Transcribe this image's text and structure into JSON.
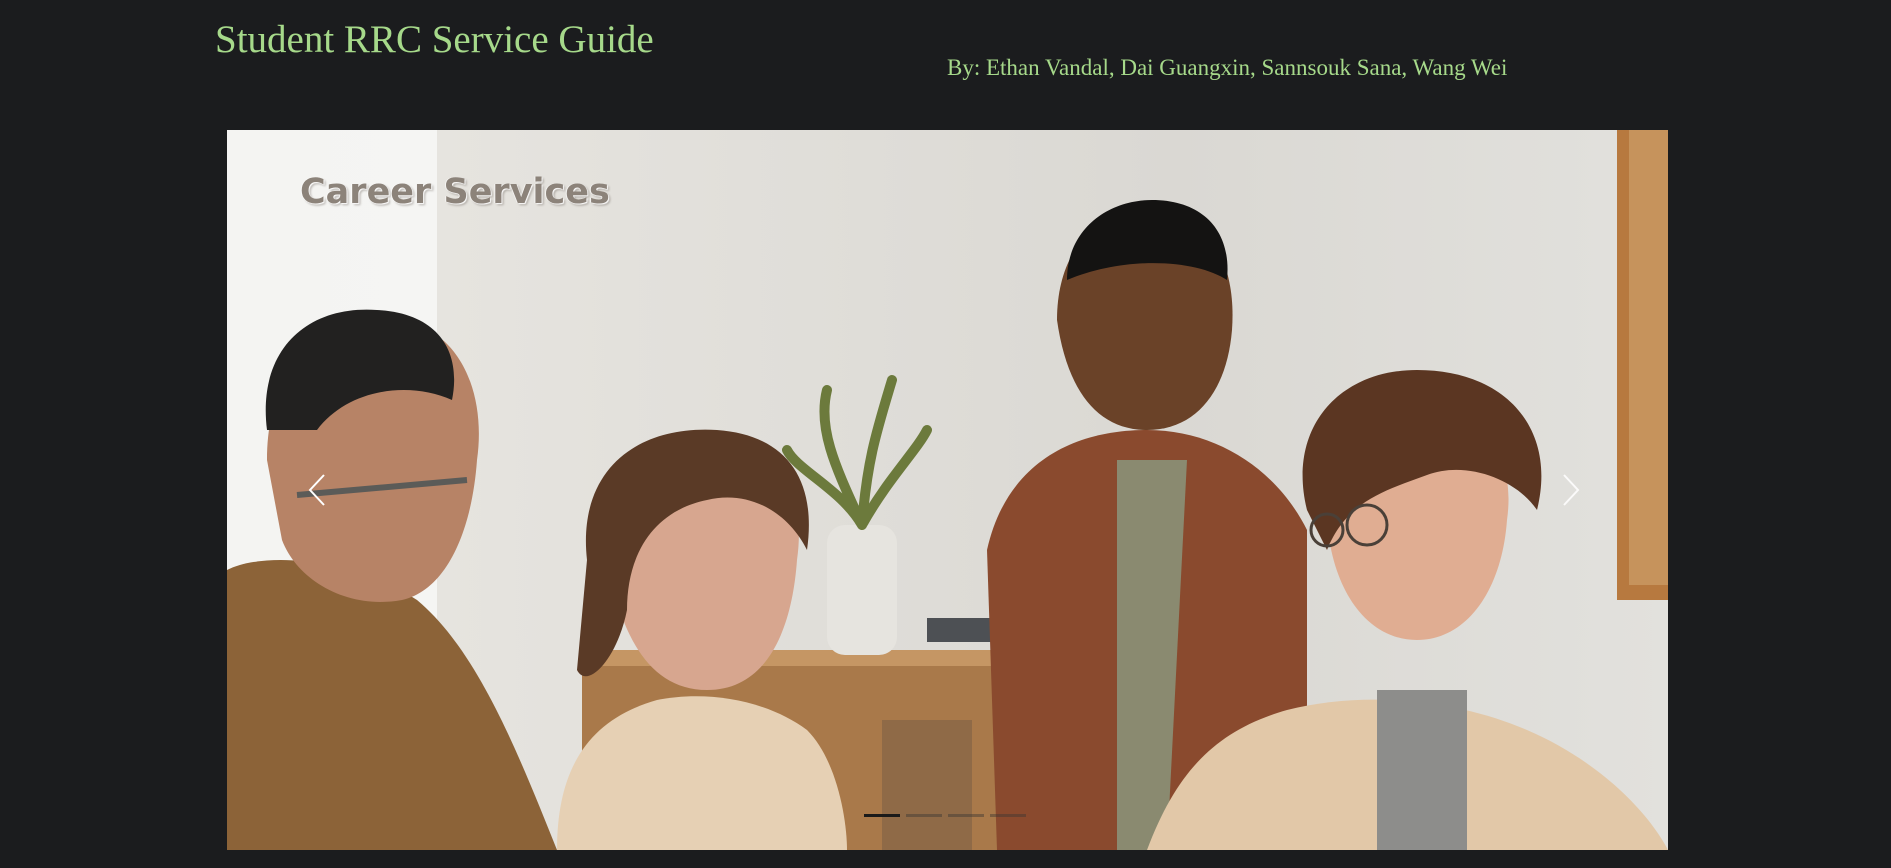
{
  "header": {
    "title": "Student RRC Service Guide",
    "authors": "By: Ethan Vandal, Dai Guangxin, Sannsouk Sana, Wang Wei"
  },
  "carousel": {
    "active_index": 0,
    "slides": [
      {
        "caption": "Career Services"
      }
    ],
    "indicator_count": 4,
    "prev_icon": "chevron-left-icon",
    "next_icon": "chevron-right-icon"
  },
  "colors": {
    "background": "#1b1c1e",
    "title_accent": "#a6d98a",
    "indicator_active": "#1a1a1a"
  }
}
